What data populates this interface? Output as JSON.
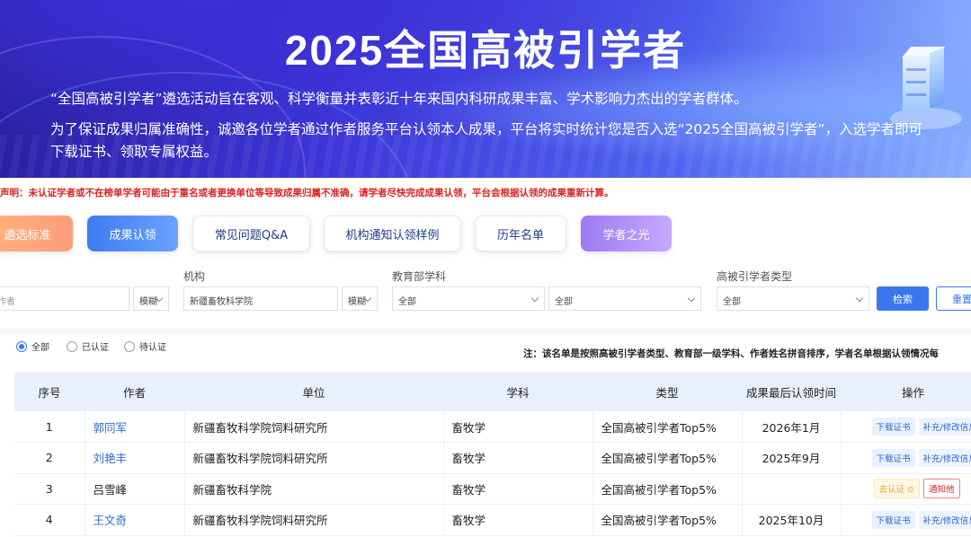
{
  "banner": {
    "title": "2025全国高被引学者",
    "intro": "“全国高被引学者”遴选活动旨在客观、科学衡量并表彰近十年来国内科研成果丰富、学术影响力杰出的学者群体。",
    "call": "为了保证成果归属准确性，诚邀各位学者通过作者服务平台认领本人成果，平台将实时统计您是否入选“2025全国高被引学者”，入选学者即可下载证书、领取专属权益。"
  },
  "notice": "声明：未认证学者或不在榜单学者可能由于重名或者更换单位等导致成果归属不准确，请学者尽快完成成果认领，平台会根据认领的成果重新计算。",
  "nav": [
    "遴选标准",
    "成果认领",
    "常见问题Q&A",
    "机构通知认领样例",
    "历年名单",
    "学者之光"
  ],
  "filters": {
    "author_placeholder": "作者",
    "match1": "模糊",
    "org_label": "机构",
    "org_value": "新疆畜牧科学院",
    "match2": "模糊",
    "subject_label": "教育部学科",
    "subject1": "全部",
    "subject2": "全部",
    "type_label": "高被引学者类型",
    "type_value": "全部",
    "search_btn": "检索",
    "reset_btn": "重置"
  },
  "status_filter": {
    "options": [
      "全部",
      "已认证",
      "待认证"
    ],
    "selected": "全部"
  },
  "note": "注：该名单是按照高被引学者类型、教育部一级学科、作者姓名拼音排序，学者名单根据认领情况每",
  "table": {
    "headers": [
      "序号",
      "作者",
      "单位",
      "学科",
      "类型",
      "成果最后认领时间",
      "操作"
    ],
    "rows": [
      {
        "no": "1",
        "author": "郭同军",
        "unit": "新疆畜牧科学院饲料研究所",
        "subject": "畜牧学",
        "type": "全国高被引学者Top5%",
        "time": "2026年1月",
        "actions": [
          "下载证书",
          "补充/修改信息"
        ]
      },
      {
        "no": "2",
        "author": "刘艳丰",
        "unit": "新疆畜牧科学院饲料研究所",
        "subject": "畜牧学",
        "type": "全国高被引学者Top5%",
        "time": "2025年9月",
        "actions": [
          "下载证书",
          "补充/修改信息"
        ]
      },
      {
        "no": "3",
        "author": "吕雪峰",
        "unit": "新疆畜牧科学院",
        "subject": "畜牧学",
        "type": "全国高被引学者Top5%",
        "time": "",
        "actions": [
          "去认证 ⊙",
          "通知他"
        ]
      },
      {
        "no": "4",
        "author": "王文奇",
        "unit": "新疆畜牧科学院饲料研究所",
        "subject": "畜牧学",
        "type": "全国高被引学者Top5%",
        "time": "2025年10月",
        "actions": [
          "下载证书",
          "补充/修改信息"
        ]
      }
    ]
  }
}
